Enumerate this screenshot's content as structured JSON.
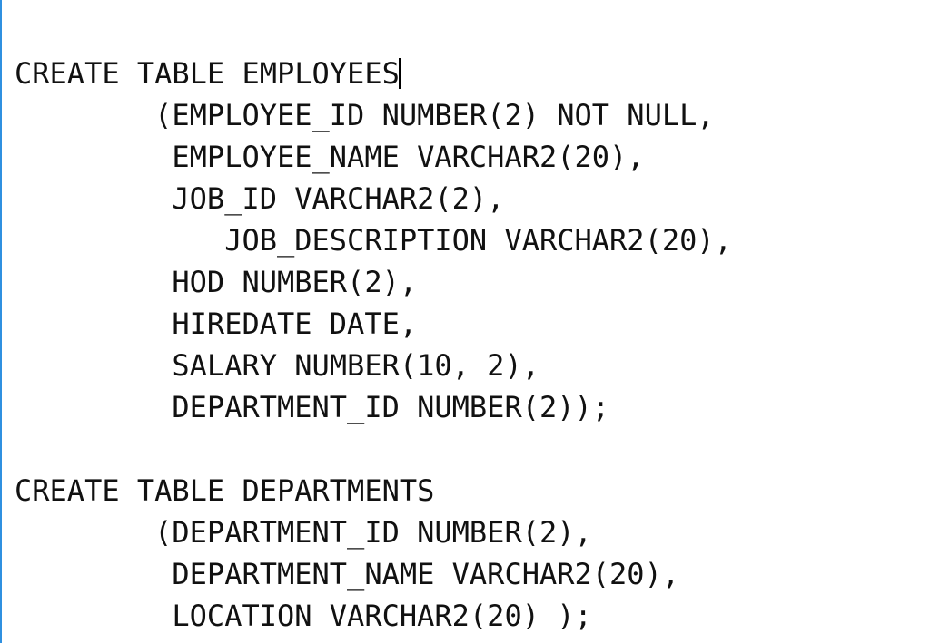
{
  "code": {
    "l1a": "CREATE TABLE EMPLOYEES",
    "l1b": "",
    "l2": "        (EMPLOYEE_ID NUMBER(2) NOT NULL,",
    "l3": "         EMPLOYEE_NAME VARCHAR2(20),",
    "l4": "         JOB_ID VARCHAR2(2),",
    "l5": "            JOB_DESCRIPTION VARCHAR2(20),",
    "l6": "         HOD NUMBER(2),",
    "l7": "         HIREDATE DATE,",
    "l8": "         SALARY NUMBER(10, 2),",
    "l9": "         DEPARTMENT_ID NUMBER(2));",
    "l10": "",
    "l11": "CREATE TABLE DEPARTMENTS",
    "l12": "        (DEPARTMENT_ID NUMBER(2),",
    "l13": "         DEPARTMENT_NAME VARCHAR2(20),",
    "l14": "         LOCATION VARCHAR2(20) );"
  }
}
